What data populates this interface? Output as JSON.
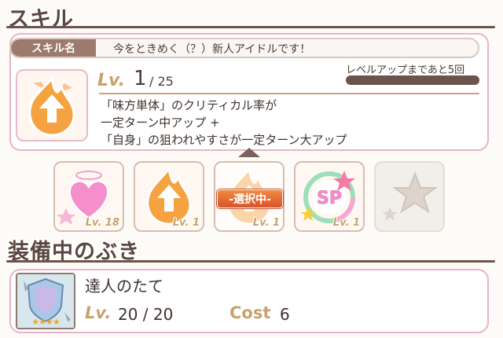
{
  "skill_section": {
    "title": "スキル",
    "name_label": "スキル名",
    "name": "今をときめく（？）新人アイドルです！",
    "lv_label": "Lv.",
    "level": "1",
    "max_level": "/ 25",
    "levelup_text": "レベルアップまであと5回",
    "description": [
      "「味方単体」のクリティカル率が",
      "一定ターン中アップ +",
      "「自身」の狙われやすさが一定ターン大アップ"
    ],
    "slots": [
      {
        "icon": "heart-halo-icon",
        "level": "Lv. 18"
      },
      {
        "icon": "fire-up-icon",
        "level": "Lv. 1"
      },
      {
        "icon": "fire-up-icon",
        "level": "Lv. 1",
        "badge": "-選択中-"
      },
      {
        "icon": "sp-star-icon",
        "level": "Lv. 1"
      },
      {
        "icon": "star-locked-icon",
        "level": ""
      }
    ]
  },
  "equipment_section": {
    "title": "装備中のぶき",
    "weapon_name": "達人のたて",
    "lv_label": "Lv.",
    "level": "20 / 20",
    "cost_label": "Cost",
    "cost": "6",
    "stars": "★★★★"
  }
}
